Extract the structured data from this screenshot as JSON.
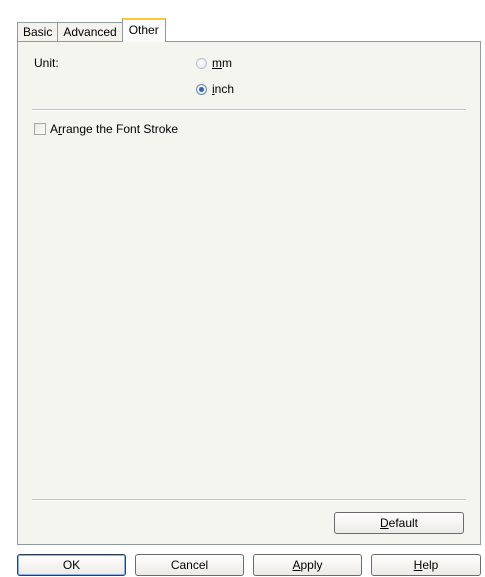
{
  "tabs": [
    {
      "label": "Basic"
    },
    {
      "label": "Advanced"
    },
    {
      "label": "Other",
      "selected": true
    }
  ],
  "unit": {
    "label": "Unit:",
    "options": [
      {
        "first": "m",
        "rest": "m",
        "checked": false
      },
      {
        "first": "i",
        "rest": "nch",
        "checked": true
      }
    ]
  },
  "arrange_font_stroke": {
    "pre": "A",
    "mnemonic": "r",
    "rest": "range the Font Stroke",
    "checked": false
  },
  "default_button": {
    "mnemonic": "D",
    "rest": "efault"
  },
  "footer": {
    "ok": "OK",
    "cancel": "Cancel",
    "apply": {
      "mnemonic": "A",
      "rest": "pply"
    },
    "help": {
      "mnemonic": "H",
      "rest": "elp"
    }
  }
}
